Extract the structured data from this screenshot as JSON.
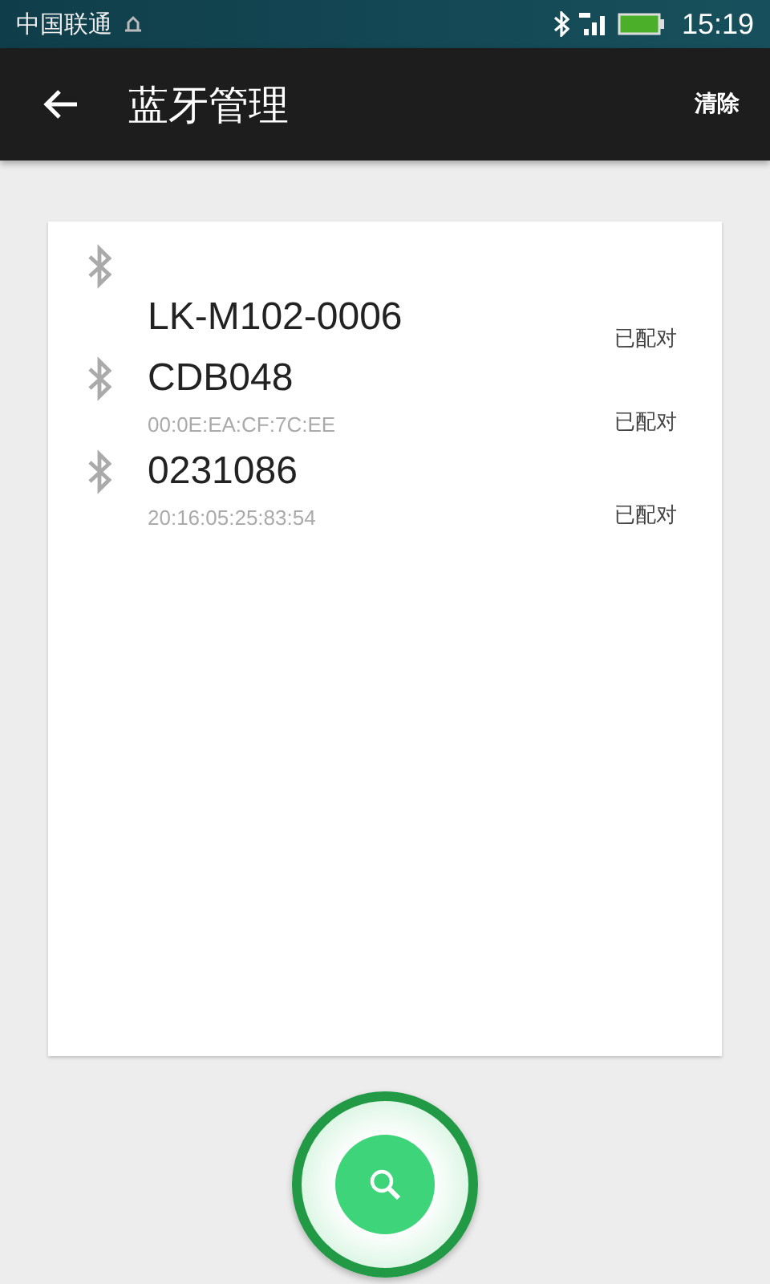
{
  "status_bar": {
    "carrier": "中国联通",
    "time": "15:19"
  },
  "app_bar": {
    "title": "蓝牙管理",
    "action": "清除"
  },
  "devices": [
    {
      "name": "LK-M102-0006",
      "status": "已配对"
    },
    {
      "name": "CDB048",
      "address": "00:0E:EA:CF:7C:EE",
      "status": "已配对"
    },
    {
      "name": "0231086",
      "address": "20:16:05:25:83:54",
      "status": "已配对"
    }
  ]
}
